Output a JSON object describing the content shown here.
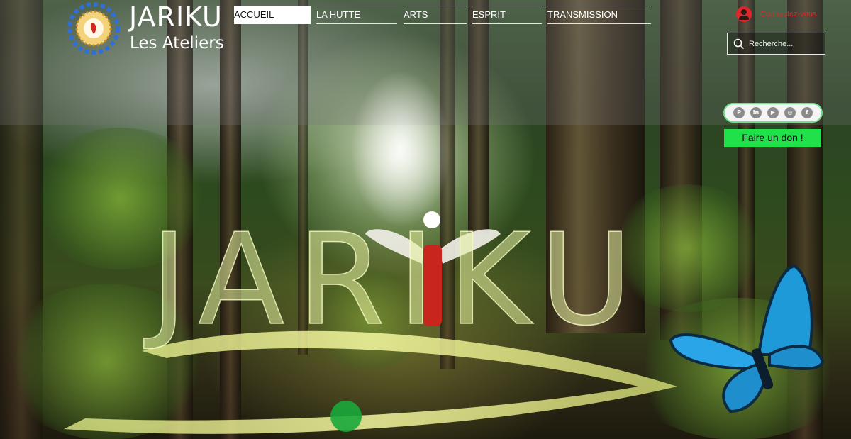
{
  "brand": {
    "name": "JARIKU",
    "subtitle": "Les Ateliers"
  },
  "nav": {
    "items": [
      {
        "label": "ACCUEIL",
        "active": true
      },
      {
        "label": "LA HUTTE",
        "active": false
      },
      {
        "label": "ARTS",
        "active": false
      },
      {
        "label": "ESPRIT",
        "active": false
      },
      {
        "label": "TRANSMISSION",
        "active": false
      }
    ]
  },
  "login": {
    "label": "Connectez-vous",
    "icon": "user-avatar-icon"
  },
  "search": {
    "placeholder": "Recherche...",
    "icon": "search-icon"
  },
  "social": {
    "icons": [
      "pinterest-icon",
      "linkedin-icon",
      "youtube-icon",
      "instagram-icon",
      "facebook-icon"
    ]
  },
  "donate": {
    "label": "Faire un don !"
  },
  "hero": {
    "title": "JARIKU"
  },
  "colors": {
    "accent_red": "#e0262b",
    "donate_green": "#21e14b",
    "social_border": "#6ee08a",
    "butterfly_blue": "#1e9ad8"
  }
}
